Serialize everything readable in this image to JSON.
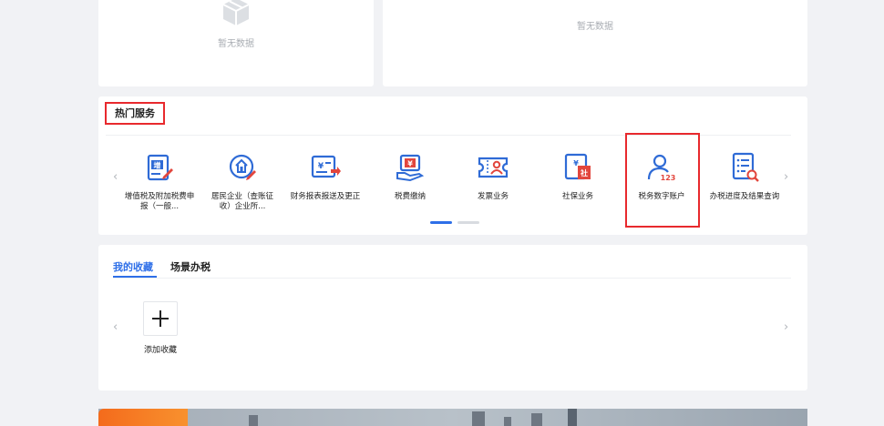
{
  "empty_panels": [
    {
      "text": "暂无数据",
      "icon": "empty-box-icon"
    },
    {
      "text": "暂无数据",
      "icon": "empty-box-icon"
    }
  ],
  "hot_services": {
    "title": "热门服务",
    "items": [
      {
        "label": "增值税及附加税费申报（一般...",
        "icon": "vat-declare-icon"
      },
      {
        "label": "居民企业（查账征收）企业所...",
        "icon": "enterprise-income-icon"
      },
      {
        "label": "财务报表报送及更正",
        "icon": "financial-report-icon"
      },
      {
        "label": "税费缴纳",
        "icon": "tax-payment-icon"
      },
      {
        "label": "发票业务",
        "icon": "invoice-icon"
      },
      {
        "label": "社保业务",
        "icon": "social-security-icon"
      },
      {
        "label": "税务数字账户",
        "icon": "tax-digital-account-icon"
      },
      {
        "label": "办税进度及结果查询",
        "icon": "progress-query-icon"
      }
    ],
    "pagination_active": 1,
    "pagination_total": 2,
    "highlighted_item": "税务数字账户"
  },
  "favorites": {
    "tabs": [
      {
        "label": "我的收藏",
        "active": true
      },
      {
        "label": "场景办税",
        "active": false
      }
    ],
    "add_label": "添加收藏"
  },
  "colors": {
    "accent": "#2e6fe8",
    "highlight_red": "#e8292d",
    "icon_blue": "#2f6bd6",
    "icon_red": "#e2463d"
  }
}
